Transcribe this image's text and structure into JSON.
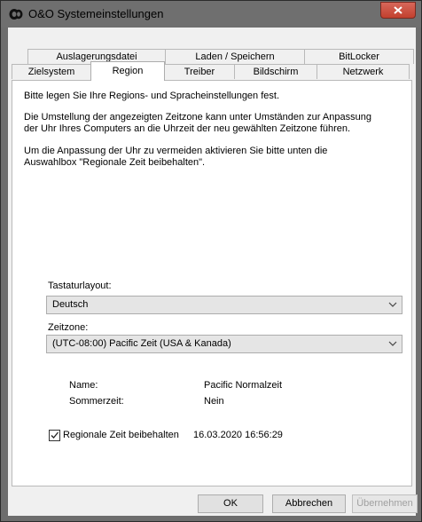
{
  "window": {
    "title": "O&O Systemeinstellungen",
    "icon": "app-icon",
    "close": "close-icon"
  },
  "tabs": {
    "back_row": [
      {
        "label": "Auslagerungsdatei"
      },
      {
        "label": "Laden / Speichern"
      },
      {
        "label": "BitLocker"
      }
    ],
    "front_row": [
      {
        "label": "Zielsystem"
      },
      {
        "label": "Region",
        "active": true
      },
      {
        "label": "Treiber"
      },
      {
        "label": "Bildschirm"
      },
      {
        "label": "Netzwerk"
      }
    ]
  },
  "region": {
    "intro": "Bitte legen Sie Ihre Regions- und Spracheinstellungen fest.",
    "info_line1": "Die Umstellung der angezeigten Zeitzone kann unter Umständen zur Anpassung",
    "info_line2": "der Uhr Ihres Computers an die Uhrzeit der neu gewählten Zeitzone führen.",
    "hint_line1": "Um die Anpassung der Uhr zu vermeiden aktivieren Sie bitte unten die",
    "hint_line2": "Auswahlbox \"Regionale Zeit beibehalten\".",
    "keyboard_label": "Tastaturlayout:",
    "keyboard_value": "Deutsch",
    "timezone_label": "Zeitzone:",
    "timezone_value": "(UTC-08:00) Pacific Zeit (USA & Kanada)",
    "name_label": "Name:",
    "name_value": "Pacific Normalzeit",
    "dst_label": "Sommerzeit:",
    "dst_value": "Nein",
    "keep_time_label": "Regionale Zeit beibehalten",
    "keep_time_checked": true,
    "datetime": "16.03.2020 16:56:29"
  },
  "buttons": {
    "ok": "OK",
    "cancel": "Abbrechen",
    "apply": "Übernehmen"
  }
}
